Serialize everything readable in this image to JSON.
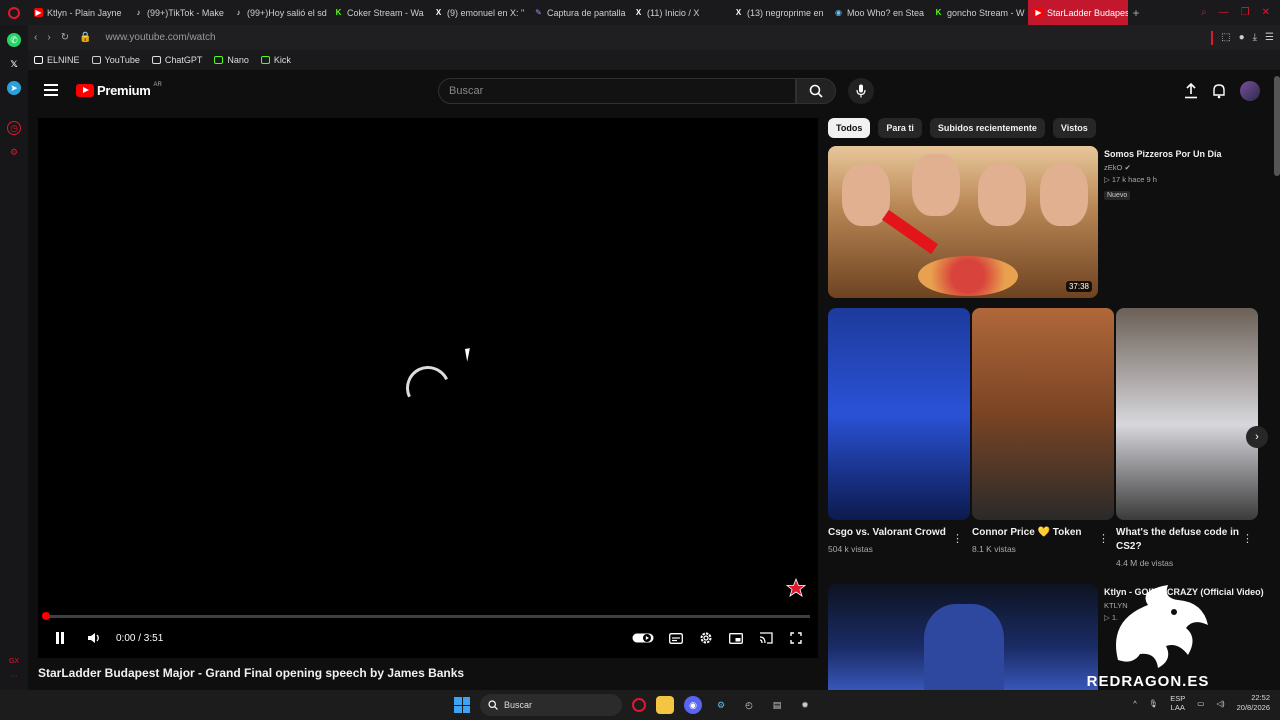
{
  "browser": {
    "tabs": [
      {
        "label": "Ktlyn - Plain Jayne",
        "icon": "youtube-icon",
        "color": "#ff0000"
      },
      {
        "label": "(99+)TikTok - Make",
        "icon": "tiktok-icon",
        "color": "#ffffff"
      },
      {
        "label": "(99+)Hoy salió el sd",
        "icon": "tiktok-icon",
        "color": "#ffffff"
      },
      {
        "label": "Coker Stream - Wa",
        "icon": "kick-icon",
        "color": "#53fc18"
      },
      {
        "label": "(9) emonuel en X: \"",
        "icon": "x-icon",
        "color": "#ffffff"
      },
      {
        "label": "Captura de pantalla",
        "icon": "pen-icon",
        "color": "#b388ff"
      },
      {
        "label": "(11) Inicio / X",
        "icon": "x-icon",
        "color": "#ffffff"
      },
      {
        "label": "(13) negroprime en",
        "icon": "x-icon",
        "color": "#ffffff"
      },
      {
        "label": "Moo Who? en Stea",
        "icon": "steam-icon",
        "color": "#66c0f4"
      },
      {
        "label": "goncho Stream - W",
        "icon": "kick-icon",
        "color": "#53fc18"
      },
      {
        "label": "StarLadder Budapest Majo",
        "icon": "youtube-icon",
        "color": "#ff0000",
        "active": true
      }
    ],
    "new_tab": "+",
    "url": "www.youtube.com/watch",
    "bookmarks": [
      {
        "label": "ELNINE",
        "color": "#ffffff"
      },
      {
        "label": "YouTube",
        "color": "#cccccc"
      },
      {
        "label": "ChatGPT",
        "color": "#dddddd"
      },
      {
        "label": "Nano",
        "color": "#53fc18"
      },
      {
        "label": "Kick",
        "color": "#53fc18"
      }
    ]
  },
  "youtube": {
    "logo_text": "Premium",
    "logo_country": "AR",
    "search_placeholder": "Buscar",
    "player": {
      "time": "0:00 / 3:51",
      "progress_fraction": 0.0
    },
    "video_title": "StarLadder Budapest Major - Grand Final opening speech by James Banks",
    "chips": [
      "Todos",
      "Para ti",
      "Subidos recientemente",
      "Vistos"
    ],
    "rec1": {
      "title": "Somos Pizzeros Por Un Día",
      "channel": "zEkO",
      "stats": "▷ 17 k  hace 9 h",
      "badge": "Nuevo",
      "duration": "37:38"
    },
    "shorts": [
      {
        "title": "Csgo vs. Valorant Crowd",
        "views": "504 k vistas"
      },
      {
        "title": "Connor Price 💛 Token",
        "views": "8.1 K vistas"
      },
      {
        "title": "What's the defuse code in CS2?",
        "views": "4.4 M de vistas"
      }
    ],
    "rec2": {
      "title": "Ktlyn - GOING CRAZY (Official Video)",
      "channel": "KTLYN",
      "stats": "▷ 1."
    }
  },
  "watermark": "REDRAGON.ES",
  "taskbar": {
    "search_label": "Buscar",
    "lang_top": "ESP",
    "lang_bottom": "LAA",
    "time": "22:52",
    "date": "20/8/2026"
  },
  "colors": {
    "accent": "#ff0000",
    "opera_red": "#e0182d",
    "background": "#0f0f0f"
  }
}
